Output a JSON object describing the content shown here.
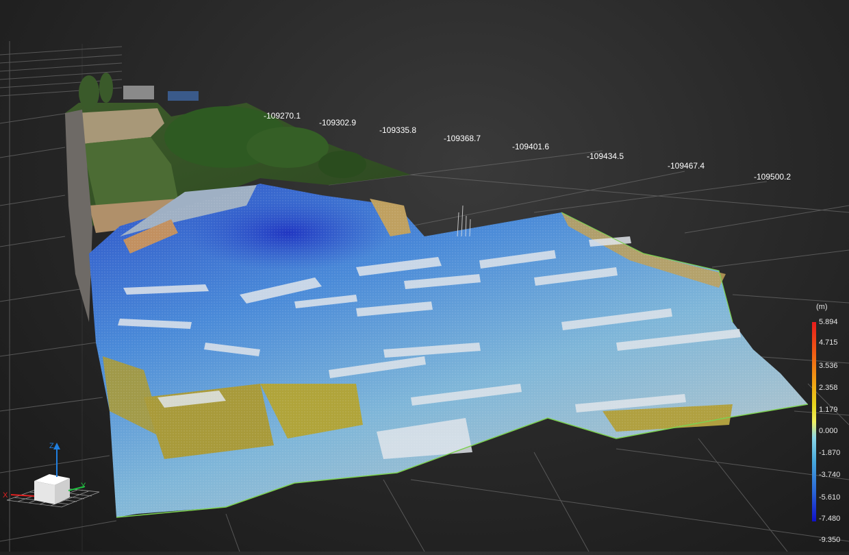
{
  "viewport": {
    "background": "#2a2a2a",
    "coordinate_labels": [
      "-109270.1",
      "-109302.9",
      "-109335.8",
      "-109368.7",
      "-109401.6",
      "-109434.5",
      "-109467.4",
      "-109500.2"
    ]
  },
  "legend": {
    "unit": "(m)",
    "ticks": [
      "5.894",
      "4.715",
      "3.536",
      "2.358",
      "1.179",
      "0.000",
      "-1.870",
      "-3.740",
      "-5.610",
      "-7.480",
      "-9.350"
    ],
    "colors": {
      "max": "#e81c1c",
      "mid": "#f0f060",
      "min": "#1010c8"
    }
  },
  "gizmo": {
    "x_label": "X",
    "y_label": "Y",
    "z_label": "Z",
    "colors": {
      "x": "#e02020",
      "y": "#20c040",
      "z": "#2080e0"
    }
  },
  "icons": {
    "gizmo": "orientation-cube-icon"
  }
}
